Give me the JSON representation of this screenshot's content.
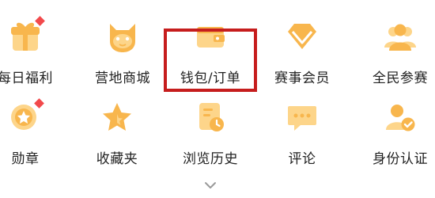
{
  "menu": {
    "row1": [
      {
        "label": "每日福利",
        "icon": "gift-icon",
        "badge": true
      },
      {
        "label": "营地商城",
        "icon": "mascot-icon",
        "badge": false
      },
      {
        "label": "钱包/订单",
        "icon": "wallet-icon",
        "badge": false,
        "highlighted": true
      },
      {
        "label": "赛事会员",
        "icon": "diamond-icon",
        "badge": false
      },
      {
        "label": "全民参赛",
        "icon": "people-icon",
        "badge": false
      }
    ],
    "row2": [
      {
        "label": "勋章",
        "icon": "medal-icon",
        "badge": true
      },
      {
        "label": "收藏夹",
        "icon": "star-icon",
        "badge": false
      },
      {
        "label": "浏览历史",
        "icon": "history-icon",
        "badge": false
      },
      {
        "label": "评论",
        "icon": "comment-icon",
        "badge": false
      },
      {
        "label": "身份认证",
        "icon": "verified-user-icon",
        "badge": false
      }
    ]
  },
  "expand_icon": "chevron-down-icon",
  "colors": {
    "icon_primary": "#f8b64d",
    "icon_secondary": "#fdd58a",
    "badge": "#f2494b",
    "highlight_border": "#c61d1d",
    "label": "#222222"
  }
}
